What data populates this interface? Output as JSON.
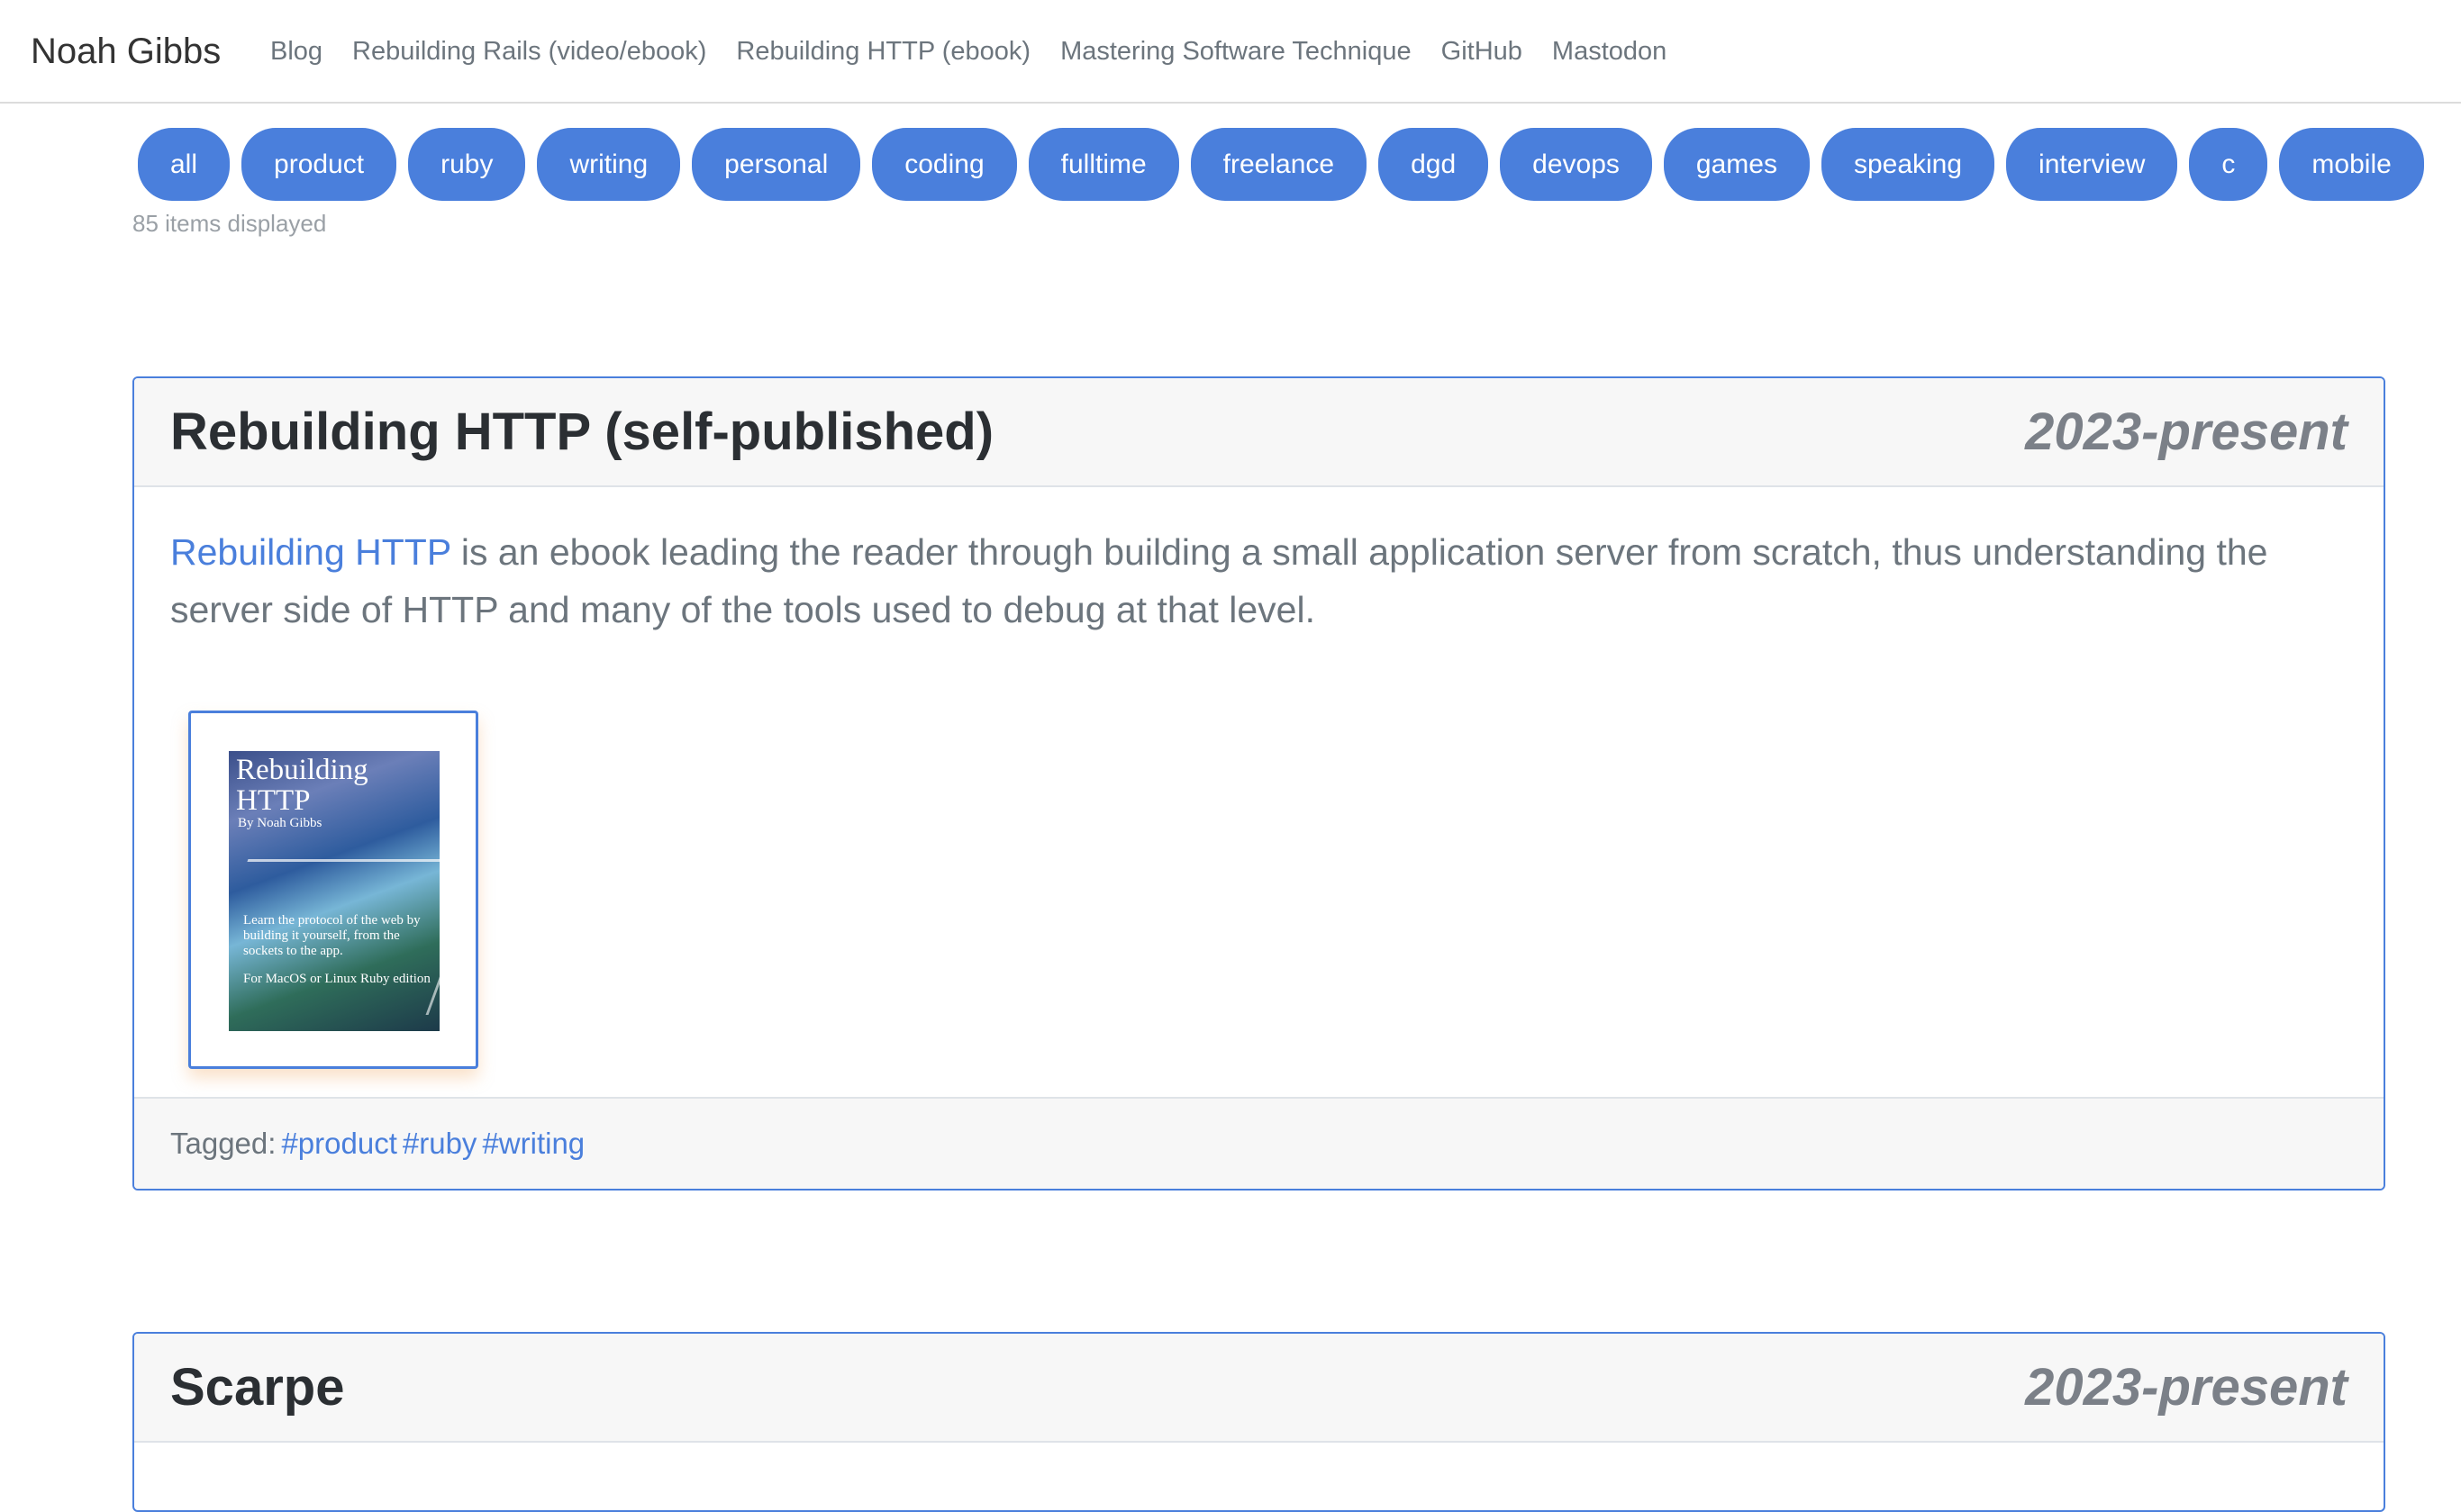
{
  "nav": {
    "brand": "Noah Gibbs",
    "links": [
      "Blog",
      "Rebuilding Rails (video/ebook)",
      "Rebuilding HTTP (ebook)",
      "Mastering Software Technique",
      "GitHub",
      "Mastodon"
    ]
  },
  "filters": {
    "tags": [
      "all",
      "product",
      "ruby",
      "writing",
      "personal",
      "coding",
      "fulltime",
      "freelance",
      "dgd",
      "devops",
      "games",
      "speaking",
      "interview",
      "c",
      "mobile"
    ],
    "count_text": "85 items displayed"
  },
  "cards": [
    {
      "title": "Rebuilding HTTP (self-published)",
      "date": "2023-present",
      "link_text": "Rebuilding HTTP",
      "description": " is an ebook leading the reader through building a small application server from scratch, thus understanding the server side of HTTP and many of the tools used to debug at that level.",
      "cover": {
        "title": "Rebuilding HTTP",
        "author": "By Noah Gibbs",
        "blurb": "Learn the protocol of the web by building it yourself, from the sockets to the app.",
        "platform": "For MacOS or Linux Ruby edition"
      },
      "tagged_label": "Tagged:",
      "tags": [
        "#product",
        "#ruby",
        "#writing"
      ]
    },
    {
      "title": "Scarpe",
      "date": "2023-present"
    }
  ],
  "colors": {
    "accent": "#4a7fdc",
    "header_bg": "#f7f7f7",
    "muted_text": "#6c757d"
  }
}
